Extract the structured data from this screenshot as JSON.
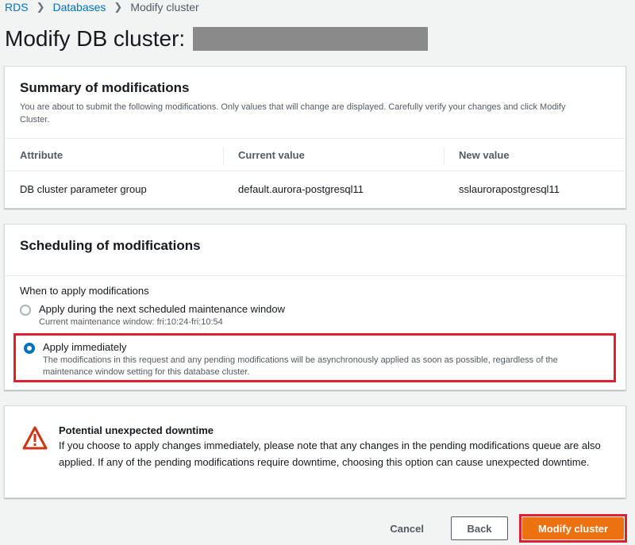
{
  "breadcrumb": [
    {
      "label": "RDS"
    },
    {
      "label": "Databases"
    },
    {
      "label": "Modify cluster"
    }
  ],
  "page": {
    "title": "Modify DB cluster:"
  },
  "summary": {
    "title": "Summary of modifications",
    "description": "You are about to submit the following modifications. Only values that will change are displayed. Carefully verify your changes and click Modify Cluster.",
    "columns": [
      "Attribute",
      "Current value",
      "New value"
    ],
    "rows": [
      [
        "DB cluster parameter group",
        "default.aurora-postgresql11",
        "sslaurorapostgresql11"
      ]
    ]
  },
  "scheduling": {
    "title": "Scheduling of modifications",
    "field_label": "When to apply modifications",
    "options": [
      {
        "label": "Apply during the next scheduled maintenance window",
        "description": "Current maintenance window: fri:10:24-fri:10:54",
        "selected": false
      },
      {
        "label": "Apply immediately",
        "description": "The modifications in this request and any pending modifications will be asynchronously applied as soon as possible, regardless of the maintenance window setting for this database cluster.",
        "selected": true
      }
    ]
  },
  "warning": {
    "icon": "warning-triangle-icon",
    "title": "Potential unexpected downtime",
    "body": "If you choose to apply changes immediately, please note that any changes in the pending modifications queue are also applied. If any of the pending modifications require downtime, choosing this option can cause unexpected downtime."
  },
  "footer": {
    "cancel_label": "Cancel",
    "back_label": "Back",
    "submit_label": "Modify cluster"
  },
  "colors": {
    "link": "#0073bb",
    "primary": "#ec7211",
    "highlight": "#e0202e",
    "warning": "#d13212"
  }
}
